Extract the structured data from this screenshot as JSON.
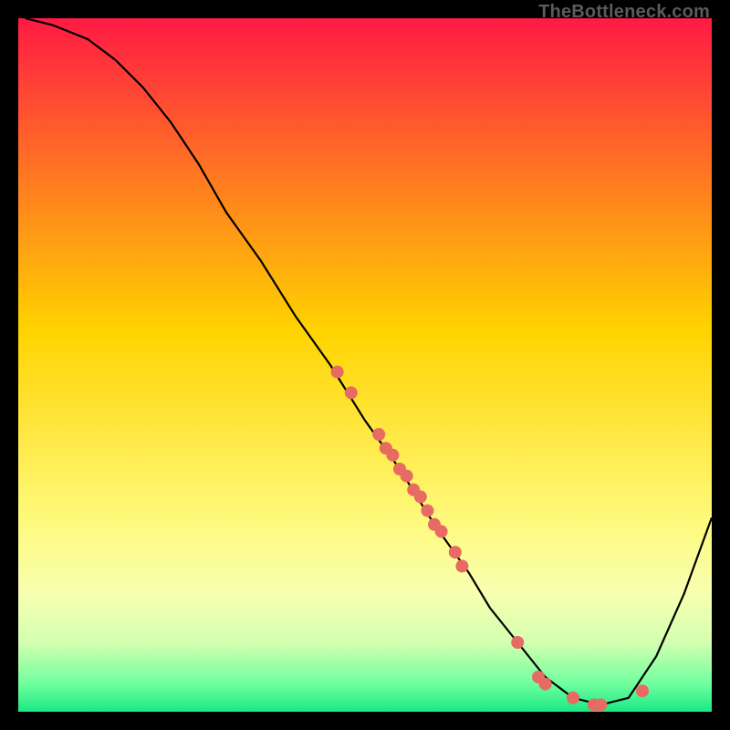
{
  "watermark": "TheBottleneck.com",
  "chart_data": {
    "type": "line",
    "title": "",
    "xlabel": "",
    "ylabel": "",
    "xlim": [
      0,
      100
    ],
    "ylim": [
      0,
      100
    ],
    "grid": false,
    "legend": false,
    "background_gradient": {
      "stops": [
        {
          "pos": 0.0,
          "color": "#ff1a44"
        },
        {
          "pos": 0.45,
          "color": "#ffd300"
        },
        {
          "pos": 0.72,
          "color": "#fff97a"
        },
        {
          "pos": 0.83,
          "color": "#f7ffb0"
        },
        {
          "pos": 0.9,
          "color": "#d4ffb0"
        },
        {
          "pos": 0.96,
          "color": "#6fff9e"
        },
        {
          "pos": 1.0,
          "color": "#19e884"
        }
      ]
    },
    "curve": {
      "x": [
        1,
        5,
        10,
        14,
        18,
        22,
        26,
        30,
        35,
        40,
        45,
        50,
        55,
        60,
        65,
        68,
        72,
        76,
        80,
        84,
        88,
        92,
        96,
        100
      ],
      "y": [
        100,
        99,
        97,
        94,
        90,
        85,
        79,
        72,
        65,
        57,
        50,
        42,
        35,
        27,
        20,
        15,
        10,
        5,
        2,
        1,
        2,
        8,
        17,
        28
      ]
    },
    "markers": {
      "x": [
        46,
        48,
        52,
        53,
        54,
        55,
        56,
        57,
        58,
        59,
        60,
        61,
        63,
        64,
        72,
        75,
        76,
        80,
        83,
        84,
        90
      ],
      "y": [
        49,
        46,
        40,
        38,
        37,
        35,
        34,
        32,
        31,
        29,
        27,
        26,
        23,
        21,
        10,
        5,
        4,
        2,
        1,
        1,
        3
      ],
      "color": "#e76a63",
      "radius": 7
    }
  }
}
